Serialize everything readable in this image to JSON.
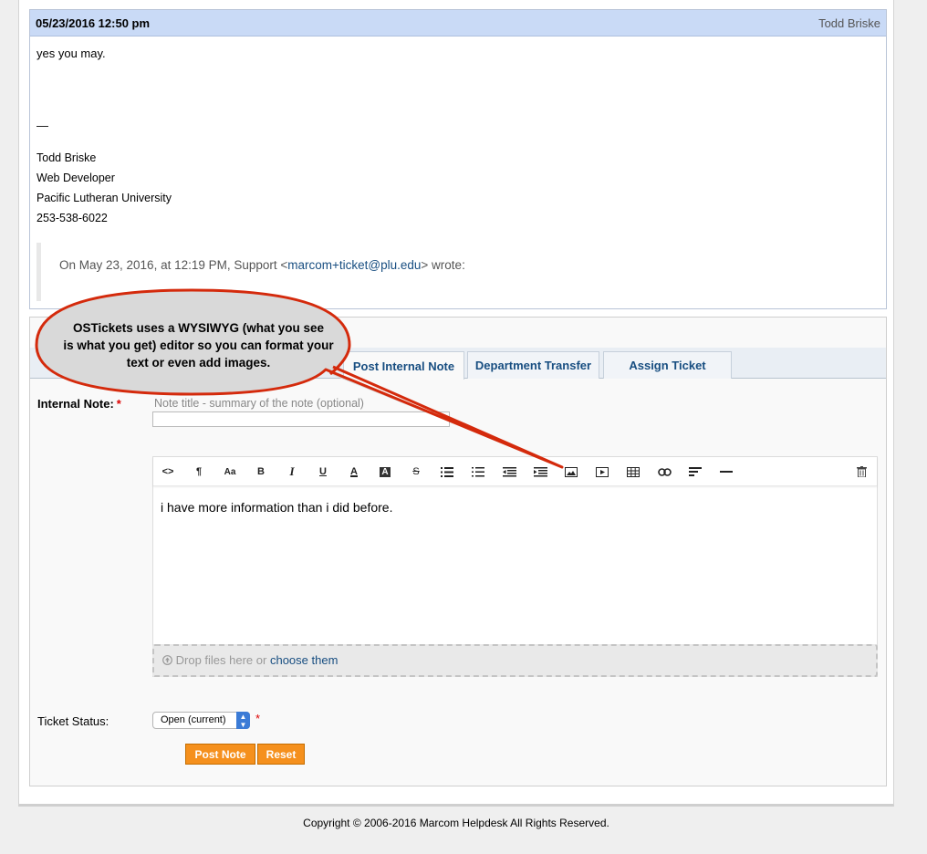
{
  "entry": {
    "date": "05/23/2016 12:50 pm",
    "author": "Todd Briske",
    "message": "yes you may.",
    "separator": "—",
    "signature": [
      "Todd Briske",
      "Web Developer",
      "Pacific Lutheran University",
      "253-538-6022"
    ],
    "quote_prefix": "On May 23, 2016, at 12:19 PM, Support <",
    "quote_email": "marcom+ticket@plu.edu",
    "quote_suffix": "> wrote:"
  },
  "callout": {
    "lines": [
      "OSTickets uses a WYSIWYG (what you see",
      "is what you get) editor so you can format your",
      "text or even add images."
    ]
  },
  "tabs": [
    {
      "label": "Post Internal Note",
      "active": true
    },
    {
      "label": "Department Transfer",
      "active": false
    },
    {
      "label": "Assign Ticket",
      "active": false
    }
  ],
  "form": {
    "internal_note_label": "Internal Note:",
    "required_mark": "*",
    "title_placeholder": "Note title - summary of the note (optional)",
    "editor_text": "i have more information than i did before.",
    "dropzone_text": "Drop files here or",
    "dropzone_link": "choose them",
    "status_label": "Ticket Status:",
    "status_value": "Open (current)",
    "post_button": "Post Note",
    "reset_button": "Reset"
  },
  "toolbar": {
    "icons": [
      "html-icon",
      "paragraph-icon",
      "font-size-icon",
      "bold-icon",
      "italic-icon",
      "underline-icon",
      "font-color-icon",
      "background-color-icon",
      "strikethrough-icon",
      "unordered-list-icon",
      "ordered-list-icon",
      "outdent-icon",
      "indent-icon",
      "image-icon",
      "video-icon",
      "table-icon",
      "link-icon",
      "align-icon",
      "horizontal-rule-icon",
      "trash-icon"
    ]
  },
  "footer": {
    "copyright": "Copyright © 2006-2016 Marcom Helpdesk All Rights Reserved."
  },
  "colors": {
    "header_bg": "#c9daf6",
    "tab_text": "#184e81",
    "button_bg": "#f5901d",
    "callout_stroke": "#d42a0c",
    "callout_fill": "#d9d9d9"
  }
}
